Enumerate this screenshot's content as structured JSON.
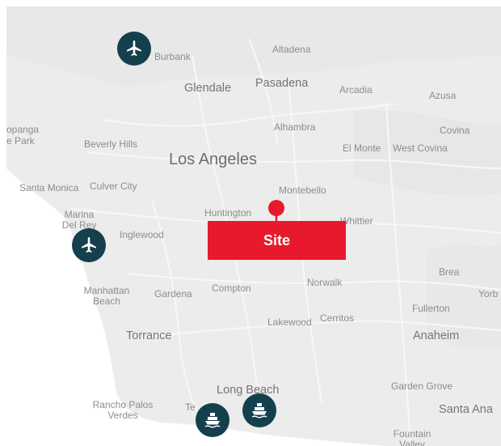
{
  "site": {
    "label": "Site",
    "color": "#e8192c"
  },
  "colors": {
    "water": "#ffffff",
    "land": "#ececec",
    "poi": "#143f4d"
  },
  "places": {
    "burbank": "Burbank",
    "altadena": "Altadena",
    "glendale": "Glendale",
    "pasadena": "Pasadena",
    "arcadia": "Arcadia",
    "azusa": "Azusa",
    "topanga": "opanga",
    "park": "e Park",
    "beverly_hills": "Beverly Hills",
    "alhambra": "Alhambra",
    "covina": "Covina",
    "los_angeles": "Los Angeles",
    "el_monte": "El Monte",
    "west_covina": "West Covina",
    "santa_monica": "Santa Monica",
    "culver_city": "Culver City",
    "montebello": "Montebello",
    "marina_del_rey": "Marina Del Rey",
    "huntington": "Huntington",
    "whittier": "Whittier",
    "inglewood": "Inglewood",
    "brea": "Brea",
    "manhattan_beach": "Manhattan Beach",
    "gardena": "Gardena",
    "compton": "Compton",
    "norwalk": "Norwalk",
    "yorba": "Yorb",
    "fullerton": "Fullerton",
    "lakewood": "Lakewood",
    "cerritos": "Cerritos",
    "torrance": "Torrance",
    "anaheim": "Anaheim",
    "garden_grove": "Garden Grove",
    "long_beach": "Long Beach",
    "rancho_palos_verdes": "Rancho Palos Verdes",
    "terminal": "Te",
    "santa_ana": "Santa Ana",
    "fountain_valley": "Fountain Valley"
  },
  "markers": {
    "burbank_airport": "airplane-icon",
    "lax_airport": "airplane-icon",
    "port_la": "ship-icon",
    "port_long_beach": "ship-icon"
  }
}
